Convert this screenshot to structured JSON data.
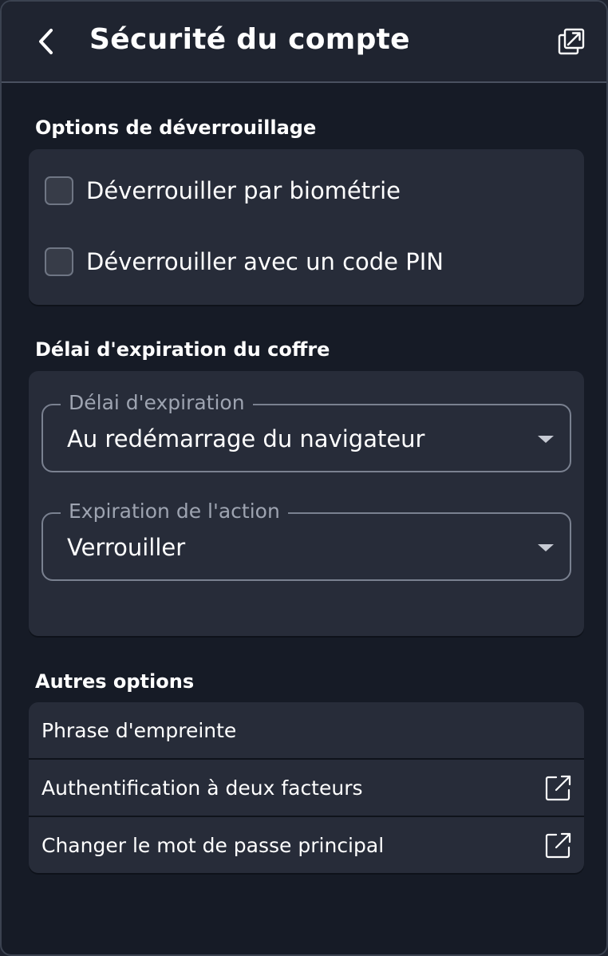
{
  "header": {
    "title": "Sécurité du compte",
    "back_icon": "chevron-left-icon",
    "popout_icon": "popout-window-icon"
  },
  "unlock_options": {
    "title": "Options de déverrouillage",
    "items": [
      {
        "label": "Déverrouiller par biométrie",
        "checked": false
      },
      {
        "label": "Déverrouiller avec un code PIN",
        "checked": false
      }
    ]
  },
  "vault_timeout": {
    "title": "Délai d'expiration du coffre",
    "timeout_select": {
      "label": "Délai d'expiration",
      "value": "Au redémarrage du navigateur"
    },
    "action_select": {
      "label": "Expiration de l'action",
      "value": "Verrouiller"
    }
  },
  "other_options": {
    "title": "Autres options",
    "items": [
      {
        "label": "Phrase d'empreinte",
        "icon": ""
      },
      {
        "label": "Authentification à deux facteurs",
        "icon": "external-link-icon"
      },
      {
        "label": "Changer le mot de passe principal",
        "icon": "external-link-icon"
      }
    ]
  },
  "colors": {
    "background": "#161b26",
    "card": "#272c39",
    "text": "#ffffff",
    "muted_text": "#9ea4b1",
    "border": "#7a8190"
  }
}
